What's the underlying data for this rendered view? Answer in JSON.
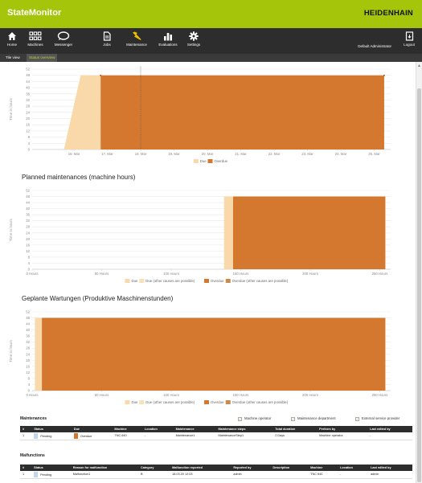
{
  "app": {
    "title": "StateMonitor",
    "brand": "HEIDENHAIN"
  },
  "nav": {
    "items": [
      {
        "label": "Home",
        "icon": "home-icon"
      },
      {
        "label": "Machines",
        "icon": "grid-icon"
      },
      {
        "label": "Messenger",
        "icon": "chat-icon"
      },
      {
        "label": "Jobs",
        "icon": "document-icon"
      },
      {
        "label": "Maintenance",
        "icon": "wrench-icon"
      },
      {
        "label": "Evaluations",
        "icon": "bar-chart-icon"
      },
      {
        "label": "Settings",
        "icon": "gear-icon"
      }
    ],
    "user": "Default Administrator",
    "logout": "Logout"
  },
  "subtabs": {
    "tile_view": "Tile view",
    "status_overview": "Status overview"
  },
  "colors": {
    "accent": "#a5c50a",
    "due": "#f9d9a9",
    "overdue": "#d4782f",
    "navbar": "#2d2d2d"
  },
  "chart_data": [
    {
      "type": "area",
      "title": "",
      "xlabel": "",
      "ylabel": "Time in hours",
      "x_ticks": [
        "16. Mar",
        "17. Mar",
        "18. Mar",
        "19. Mar",
        "20. Mar",
        "21. Mar",
        "22. Mar",
        "23. Mar",
        "24. Mar",
        "25. Mar"
      ],
      "y_ticks": [
        0,
        4,
        8,
        12,
        16,
        20,
        24,
        28,
        32,
        36,
        40,
        44,
        48,
        52
      ],
      "ylim": [
        0,
        52
      ],
      "legend": [
        "Due",
        "Overdue"
      ],
      "legend_position": "bottom-center",
      "series": [
        {
          "name": "Due",
          "x": [
            "15.7 Mar",
            "16.2 Mar",
            "16.8 Mar"
          ],
          "values": [
            0,
            48,
            48
          ]
        },
        {
          "name": "Overdue",
          "x": [
            "16.8 Mar",
            "25.3 Mar"
          ],
          "values": [
            48,
            48
          ]
        }
      ],
      "markers": {
        "x_start": "16.8 Mar",
        "x_end": "25.3 Mar",
        "value": 48
      },
      "current_time": "18. Mar",
      "grid": true
    },
    {
      "type": "area",
      "title": "Planned maintenances (machine hours)",
      "xlabel": "",
      "ylabel": "Time in hours",
      "x_ticks": [
        "0 Hours",
        "50 Hours",
        "100 Hours",
        "150 Hours",
        "200 Hours",
        "250 Hours"
      ],
      "y_ticks": [
        0,
        4,
        8,
        12,
        16,
        20,
        24,
        28,
        32,
        36,
        40,
        44,
        48,
        52
      ],
      "ylim": [
        0,
        52
      ],
      "legend": [
        "Due",
        "Due (other causes are possible)",
        "Overdue",
        "Overdue (other causes are possible)"
      ],
      "legend_position": "bottom-center",
      "series": [
        {
          "name": "Due",
          "x": [
            138,
            144.5
          ],
          "values": [
            48,
            48
          ]
        },
        {
          "name": "Overdue",
          "x": [
            144.5,
            254
          ],
          "values": [
            48,
            48
          ]
        }
      ],
      "grid": true
    },
    {
      "type": "area",
      "title": "Geplante Wartungen (Produktive Maschinenstunden)",
      "xlabel": "",
      "ylabel": "Time in hours",
      "x_ticks": [
        "0 Hours",
        "50 Hours",
        "100 Hours",
        "150 Hours",
        "200 Hours",
        "250 Hours"
      ],
      "y_ticks": [
        0,
        4,
        8,
        12,
        16,
        20,
        24,
        28,
        32,
        36,
        40,
        44,
        48,
        52
      ],
      "ylim": [
        0,
        52
      ],
      "legend": [
        "Due",
        "Due (other causes are possible)",
        "Overdue",
        "Overdue (other causes are possible)"
      ],
      "legend_position": "bottom-center",
      "series": [
        {
          "name": "Due",
          "x": [
            2,
            7
          ],
          "values": [
            48,
            48
          ]
        },
        {
          "name": "Overdue",
          "x": [
            7,
            254
          ],
          "values": [
            48,
            48
          ]
        }
      ],
      "grid": true
    }
  ],
  "maintenances": {
    "title": "Maintenances",
    "filters": [
      "Machine operator",
      "Maintenance department",
      "External service provider"
    ],
    "columns": [
      "#",
      "Status",
      "Due",
      "Machine",
      "Location",
      "Maintenance",
      "Maintenance steps",
      "Total duration",
      "Perform by",
      "Last edited by"
    ],
    "rows": [
      [
        "1",
        "Pending",
        "Overdue",
        "TNC 640",
        "-",
        "Maintenance1",
        "MaintenanceStep1",
        "2 Days",
        "Machine operator",
        "-"
      ]
    ]
  },
  "malfunctions": {
    "title": "Malfunctions",
    "columns": [
      "#",
      "Status",
      "Reason for malfunction",
      "Category",
      "Malfunction reported",
      "Reported by",
      "Description",
      "Machine",
      "Location",
      "Last edited by"
    ],
    "rows": [
      [
        "1",
        "Pending",
        "Malfunction1",
        "B",
        "18.03.20 12:03",
        "admin",
        "",
        "TNC 640",
        "-",
        "admin"
      ]
    ]
  }
}
